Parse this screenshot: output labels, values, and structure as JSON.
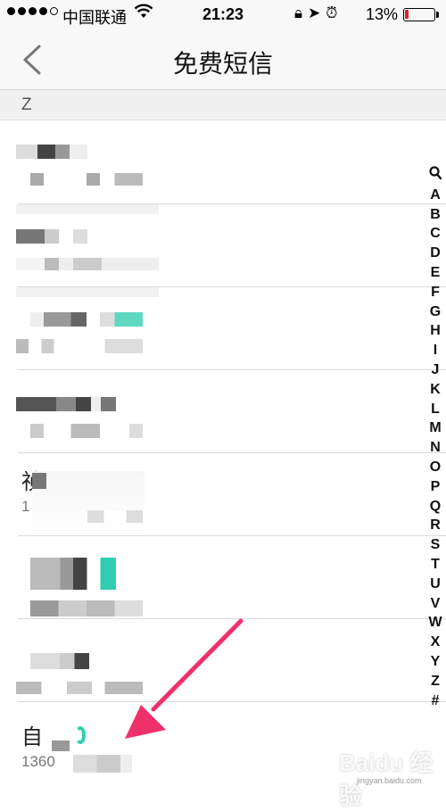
{
  "status_bar": {
    "carrier": "中国联通",
    "time": "21:23",
    "battery": "13%",
    "battery_level": 0.13,
    "wifi_icon": "wifi-icon",
    "icons": [
      "rotation-lock-icon",
      "location-icon",
      "alarm-icon"
    ]
  },
  "nav": {
    "back_icon": "chevron-left-icon",
    "title": "免费短信"
  },
  "section": {
    "letter": "Z"
  },
  "contacts": [
    {
      "name": "",
      "phone": ""
    },
    {
      "name": "",
      "phone": ""
    },
    {
      "name": "",
      "phone": ""
    },
    {
      "name": "",
      "phone": ""
    },
    {
      "name": "祯",
      "phone": "1"
    },
    {
      "name": "",
      "phone": ""
    },
    {
      "name": "",
      "phone": ""
    },
    {
      "name": "自",
      "phone": "1360"
    }
  ],
  "index_bar": {
    "search_icon": "search-icon",
    "letters": [
      "A",
      "B",
      "C",
      "D",
      "E",
      "F",
      "G",
      "H",
      "I",
      "J",
      "K",
      "L",
      "M",
      "N",
      "O",
      "P",
      "Q",
      "R",
      "S",
      "T",
      "U",
      "V",
      "W",
      "X",
      "Y",
      "Z",
      "#"
    ]
  },
  "annotation": {
    "arrow_color": "#f0306a"
  },
  "watermark": {
    "logo": "Baidu 经验",
    "url": "jingyan.baidu.com"
  }
}
